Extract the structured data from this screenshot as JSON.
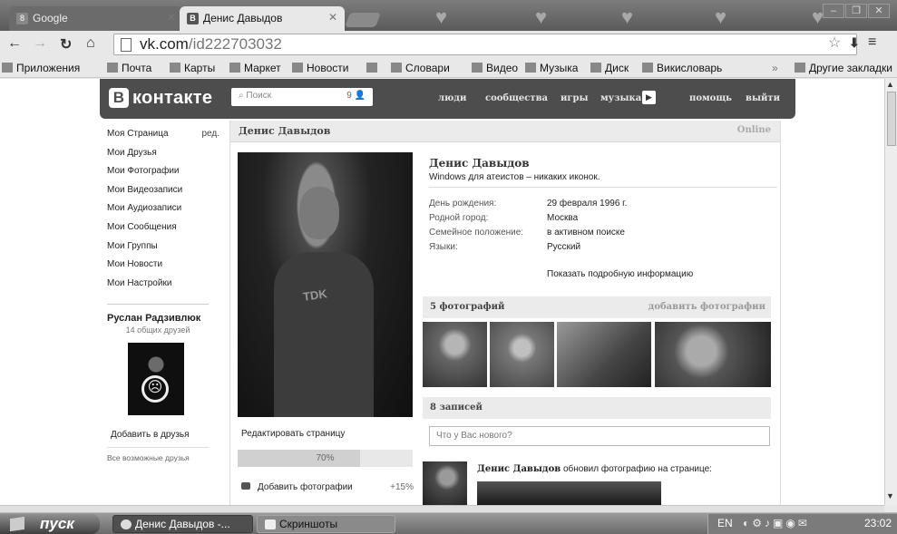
{
  "browser": {
    "tabs": [
      {
        "label": "Google",
        "favicon": "8"
      },
      {
        "label": "Денис Давыдов",
        "favicon": "В"
      }
    ],
    "url_host": "vk.com",
    "url_path": "/id222703032",
    "bookmarks": [
      "Приложения",
      "Почта",
      "Карты",
      "Маркет",
      "Новости",
      "Словари",
      "Видео",
      "Музыка",
      "Диск",
      "Викисловарь"
    ],
    "other_bookmarks": "Другие закладки"
  },
  "vk": {
    "logo": "контакте",
    "logo_letter": "В",
    "search_placeholder": "Поиск",
    "search_count": "9",
    "nav": [
      "люди",
      "сообщества",
      "игры",
      "музыка",
      "помощь",
      "выйти"
    ]
  },
  "left_menu": {
    "items": [
      "Моя Страница",
      "Мои Друзья",
      "Мои Фотографии",
      "Мои Видеозаписи",
      "Мои Аудиозаписи",
      "Мои Сообщения",
      "Мои Группы",
      "Мои Новости",
      "Мои Настройки"
    ],
    "edit_label": "ред.",
    "friend_name": "Руслан Радзивлюк",
    "friend_mutual": "14 общих друзей",
    "add_friend": "Добавить в друзья",
    "all_possible": "Все возможные друзья"
  },
  "profile": {
    "header_name": "Денис Давыдов",
    "online": "Online",
    "name": "Денис Давыдов",
    "status": "Windows для атеистов – никаких иконок.",
    "info": [
      {
        "key": "День рождения:",
        "value": "29 февраля 1996 г."
      },
      {
        "key": "Родной город:",
        "value": "Москва"
      },
      {
        "key": "Семейное положение:",
        "value": "в активном поиске"
      },
      {
        "key": "Языки:",
        "value": "Русский"
      }
    ],
    "show_more": "Показать подробную информацию",
    "edit_page": "Редактировать страницу",
    "progress": 70,
    "progress_label": "70%",
    "add_photos": "Добавить фотографии",
    "add_photos_pct": "+15%",
    "photos_title": "5 фотографий",
    "photos_add": "добавить фотографии",
    "wall_title": "8 записей",
    "wall_placeholder": "Что у Вас нового?",
    "post_author": "Денис Давыдов",
    "post_text": "обновил фотографию на странице:"
  },
  "taskbar": {
    "start": "пуск",
    "windows": [
      "Денис Давыдов -...",
      "Скриншоты"
    ],
    "lang": "EN",
    "clock": "23:02"
  }
}
